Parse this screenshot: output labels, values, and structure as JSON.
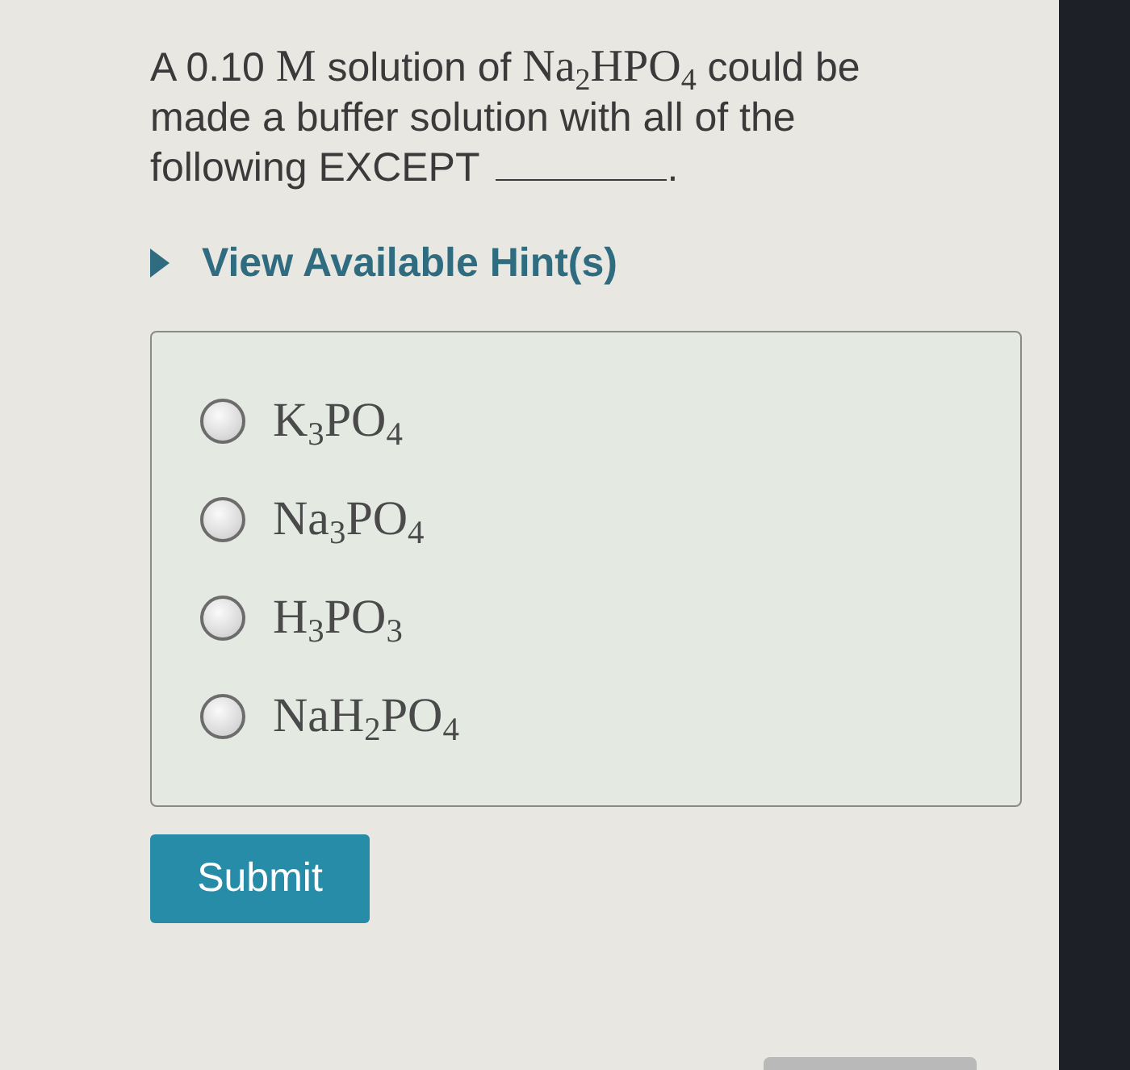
{
  "question": {
    "parts": [
      {
        "kind": "text",
        "text": "A 0.10 "
      },
      {
        "kind": "math",
        "text": "M"
      },
      {
        "kind": "text",
        "text": " solution of "
      },
      {
        "kind": "math",
        "text": "Na$_{2}$HPO$_{4}$"
      },
      {
        "kind": "text",
        "text": " could be made a buffer solution with all of the following EXCEPT"
      },
      {
        "kind": "blank"
      },
      {
        "kind": "text",
        "text": "."
      }
    ]
  },
  "hint_toggle": {
    "label": "View Available Hint(s)",
    "expanded": false
  },
  "options": [
    {
      "label": "K$_{3}$PO$_{4}$",
      "selected": false
    },
    {
      "label": "Na$_{3}$PO$_{4}$",
      "selected": false
    },
    {
      "label": "H$_{3}$PO$_{3}$",
      "selected": false
    },
    {
      "label": "NaH$_{2}$PO$_{4}$",
      "selected": false
    }
  ],
  "submit": {
    "label": "Submit"
  }
}
